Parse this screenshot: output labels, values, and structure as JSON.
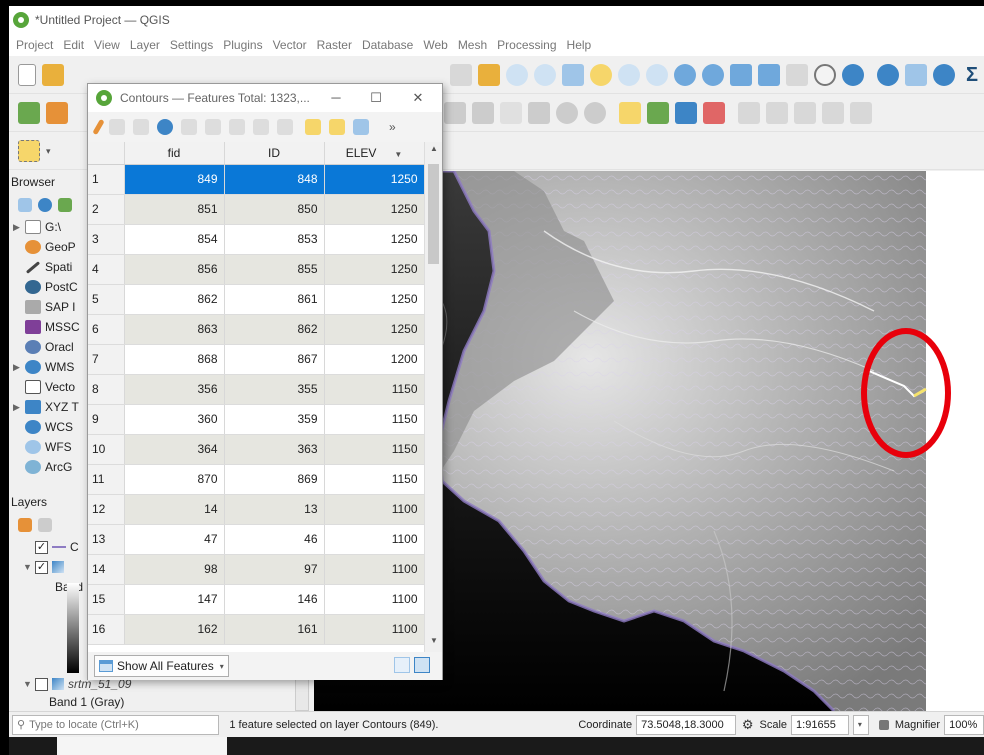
{
  "app": {
    "window_title": "*Untitled Project — QGIS"
  },
  "menu": [
    "Project",
    "Edit",
    "View",
    "Layer",
    "Settings",
    "Plugins",
    "Vector",
    "Raster",
    "Database",
    "Web",
    "Mesh",
    "Processing",
    "Help"
  ],
  "browser_panel": {
    "title": "Browser",
    "items": [
      {
        "label": "G:\\",
        "icon": "folder-icon"
      },
      {
        "label": "GeoP",
        "icon": "geopackage-icon"
      },
      {
        "label": "Spati",
        "icon": "spatialite-icon"
      },
      {
        "label": "PostC",
        "icon": "postgis-icon"
      },
      {
        "label": "SAP I",
        "icon": "sap-hana-icon"
      },
      {
        "label": "MSSC",
        "icon": "mssql-icon"
      },
      {
        "label": "Oracl",
        "icon": "oracle-icon"
      },
      {
        "label": "WMS",
        "icon": "wms-icon"
      },
      {
        "label": "Vecto",
        "icon": "vector-tiles-icon"
      },
      {
        "label": "XYZ T",
        "icon": "xyz-tiles-icon"
      },
      {
        "label": "WCS",
        "icon": "wcs-icon"
      },
      {
        "label": "WFS",
        "icon": "wfs-icon"
      },
      {
        "label": "ArcG",
        "icon": "arcgis-icon"
      }
    ]
  },
  "layers_panel": {
    "title": "Layers",
    "layers": [
      {
        "label": "C",
        "checked": true
      },
      {
        "label": "",
        "checked": true
      },
      {
        "label": "Band",
        "checked": false
      },
      {
        "label": "srtm_51_09",
        "checked": false
      },
      {
        "label": "Band 1 (Gray)",
        "checked": false
      }
    ]
  },
  "attribute_table": {
    "title": "Contours — Features Total: 1323,...",
    "columns": [
      "fid",
      "ID",
      "ELEV"
    ],
    "rows": [
      {
        "n": "1",
        "fid": "849",
        "id": "848",
        "elev": "1250",
        "selected": true
      },
      {
        "n": "2",
        "fid": "851",
        "id": "850",
        "elev": "1250"
      },
      {
        "n": "3",
        "fid": "854",
        "id": "853",
        "elev": "1250"
      },
      {
        "n": "4",
        "fid": "856",
        "id": "855",
        "elev": "1250"
      },
      {
        "n": "5",
        "fid": "862",
        "id": "861",
        "elev": "1250"
      },
      {
        "n": "6",
        "fid": "863",
        "id": "862",
        "elev": "1250"
      },
      {
        "n": "7",
        "fid": "868",
        "id": "867",
        "elev": "1200"
      },
      {
        "n": "8",
        "fid": "356",
        "id": "355",
        "elev": "1150"
      },
      {
        "n": "9",
        "fid": "360",
        "id": "359",
        "elev": "1150"
      },
      {
        "n": "10",
        "fid": "364",
        "id": "363",
        "elev": "1150"
      },
      {
        "n": "11",
        "fid": "870",
        "id": "869",
        "elev": "1150"
      },
      {
        "n": "12",
        "fid": "14",
        "id": "13",
        "elev": "1100"
      },
      {
        "n": "13",
        "fid": "47",
        "id": "46",
        "elev": "1100"
      },
      {
        "n": "14",
        "fid": "98",
        "id": "97",
        "elev": "1100"
      },
      {
        "n": "15",
        "fid": "147",
        "id": "146",
        "elev": "1100"
      },
      {
        "n": "16",
        "fid": "162",
        "id": "161",
        "elev": "1100"
      }
    ],
    "show_all_label": "Show All Features"
  },
  "status": {
    "locate_placeholder": "Type to locate (Ctrl+K)",
    "message": "1 feature selected on layer Contours (849).",
    "coordinate_label": "Coordinate",
    "coordinate_value": "73.5048,18.3000",
    "scale_label": "Scale",
    "scale_value": "1:91655",
    "magnifier_label": "Magnifier",
    "magnifier_value": "100%"
  },
  "colors": {
    "selection": "#0a78d7",
    "highlight_ellipse": "#e8000b",
    "contour_lines": "#b9a6d6"
  }
}
